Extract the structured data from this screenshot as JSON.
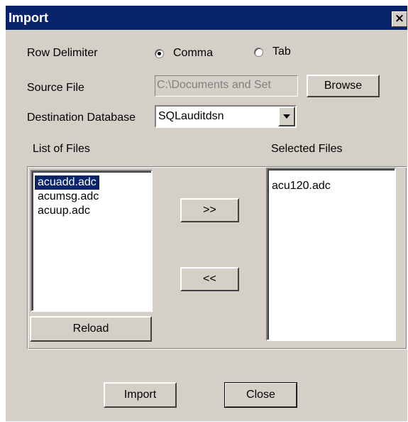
{
  "window": {
    "title": "Import",
    "close_glyph": "×"
  },
  "row_delimiter": {
    "label": "Row Delimiter",
    "options": [
      {
        "label": "Comma",
        "selected": true
      },
      {
        "label": "Tab",
        "selected": false
      }
    ]
  },
  "source_file": {
    "label": "Source File",
    "value": "C:\\Documents and Set",
    "browse_label": "Browse"
  },
  "destination": {
    "label": "Destination Database",
    "selected_value": "SQLauditdsn"
  },
  "list_of_files": {
    "label": "List of Files",
    "items": [
      "acuadd.adc",
      "acumsg.adc",
      "acuup.adc"
    ],
    "selected_index": 0
  },
  "selected_files": {
    "label": "Selected Files",
    "items": [
      "acu120.adc"
    ]
  },
  "buttons": {
    "add": ">>",
    "remove": "<<",
    "reload": "Reload",
    "import": "Import",
    "close": "Close"
  },
  "colors": {
    "title_bar": "#0a246a",
    "dialog_face": "#d4d0c8",
    "selection": "#0a246a"
  }
}
